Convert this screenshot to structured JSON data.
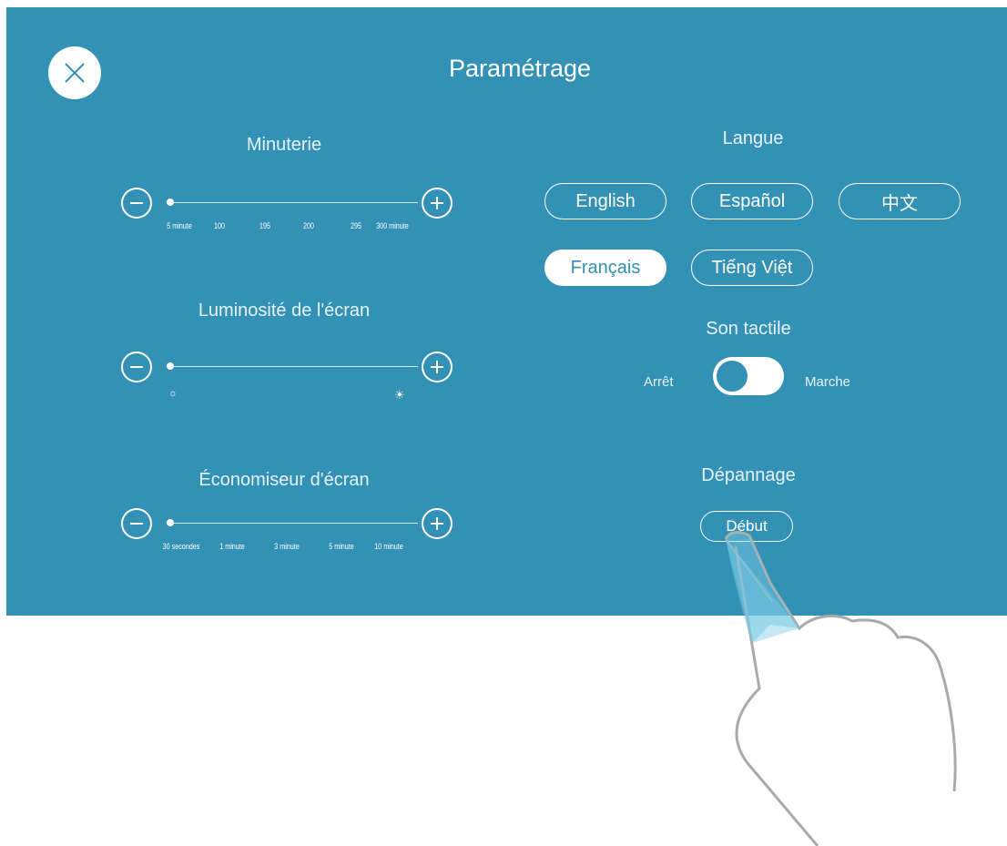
{
  "header": {
    "title": "Paramétrage",
    "close_icon": "close-icon"
  },
  "timer": {
    "label": "Minuterie",
    "value": 5,
    "ticks": [
      "5 minute",
      "100",
      "195",
      "200",
      "295",
      "300 minute"
    ]
  },
  "brightness": {
    "label": "Luminosité de l'écran",
    "low_icon": "dim-sun-icon",
    "high_icon": "bright-sun-icon",
    "low_symbol": "☼",
    "high_symbol": "☀"
  },
  "screensaver": {
    "label": "Économiseur d'écran",
    "ticks": [
      "30 secondes",
      "1 minute",
      "3 minute",
      "5 minute",
      "10 minute"
    ]
  },
  "language": {
    "label": "Langue",
    "options": [
      "English",
      "Español",
      "中文",
      "Français",
      "Tiếng Việt"
    ],
    "selected": "Français"
  },
  "touch_sound": {
    "label": "Son tactile",
    "off_label": "Arrêt",
    "on_label": "Marche",
    "state": "on"
  },
  "troubleshooting": {
    "label": "Dépannage",
    "button_label": "Début"
  },
  "colors": {
    "panel": "#3391b5",
    "foreground": "#ffffff",
    "hand_outline": "#aaaaaa"
  }
}
